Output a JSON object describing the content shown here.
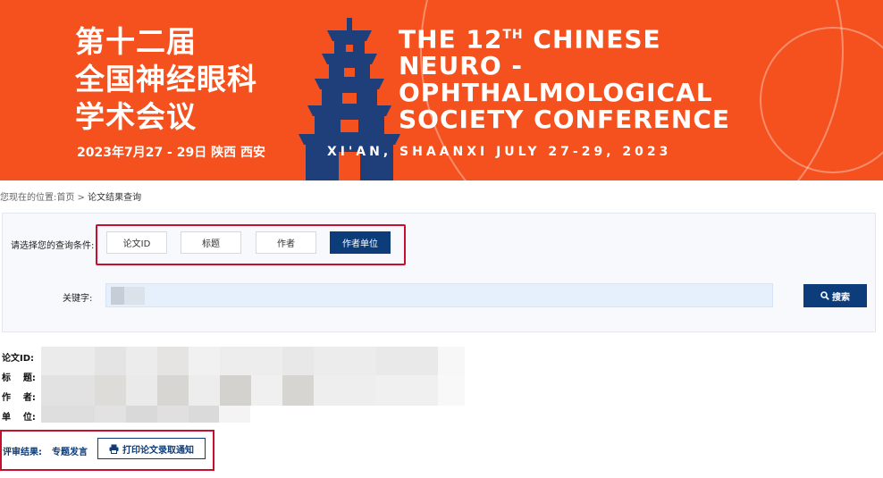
{
  "banner": {
    "cn_title_line1": "第十二届",
    "cn_title_line2": "全国神经眼科",
    "cn_title_line3": "学术会议",
    "cn_date": "2023年7月27 - 29日  陕西  西安",
    "en_title_line1_a": "THE 12",
    "en_title_line1_sup": "TH",
    "en_title_line1_b": " CHINESE",
    "en_title_line2": "NEURO -",
    "en_title_line3": "OPHTHALMOLOGICAL",
    "en_title_line4": "SOCIETY CONFERENCE",
    "en_date": "XI'AN, SHAANXI JULY 27-29,  2023",
    "bg_color": "#f4511e"
  },
  "breadcrumb": {
    "prefix": "您现在的位置:",
    "home": "首页",
    "separator": " > ",
    "current": "论文结果查询"
  },
  "query": {
    "condition_label": "请选择您的查询条件:",
    "conditions": [
      {
        "label": "论文ID",
        "active": false
      },
      {
        "label": "标题",
        "active": false
      },
      {
        "label": "作者",
        "active": false
      },
      {
        "label": "作者单位",
        "active": true
      }
    ],
    "keyword_label": "关键字:",
    "keyword_value": "",
    "search_label": "搜索",
    "accent": "#0d3c7a"
  },
  "results": {
    "id_label": "论文ID:",
    "title_label": "标    题:",
    "author_label": "作    者:",
    "unit_label": "单    位:"
  },
  "review": {
    "label": "评审结果:",
    "value": "专题发言",
    "print_label": "打印论文录取通知"
  }
}
